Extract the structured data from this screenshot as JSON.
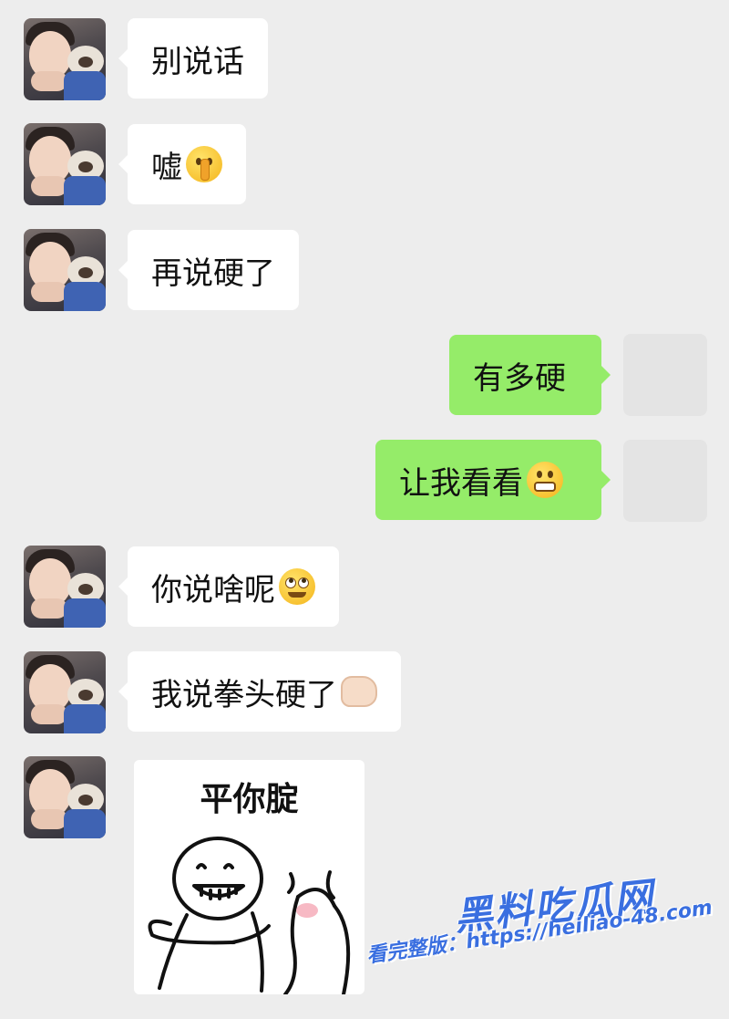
{
  "messages": [
    {
      "side": "in",
      "text": "别说话",
      "emoji": ""
    },
    {
      "side": "in",
      "text": "嘘",
      "emoji": "shushing-face"
    },
    {
      "side": "in",
      "text": "再说硬了",
      "emoji": ""
    },
    {
      "side": "out",
      "text": "有多硬",
      "emoji": ""
    },
    {
      "side": "out",
      "text": "让我看看",
      "emoji": "grimacing-face"
    },
    {
      "side": "in",
      "text": "你说啥呢",
      "emoji": "eye-roll-face"
    },
    {
      "side": "in",
      "text": "我说拳头硬了",
      "emoji": "fist"
    }
  ],
  "sticker": {
    "caption": "平你腚",
    "description": "stick-figure-spanking-sticker"
  },
  "watermark": {
    "logo": "黑料吃瓜网",
    "url": "看完整版：https://heiliao-48.com"
  },
  "colors": {
    "background": "#ededed",
    "incoming_bubble": "#ffffff",
    "outgoing_bubble": "#95ec69",
    "watermark": "#3a6fe0"
  }
}
